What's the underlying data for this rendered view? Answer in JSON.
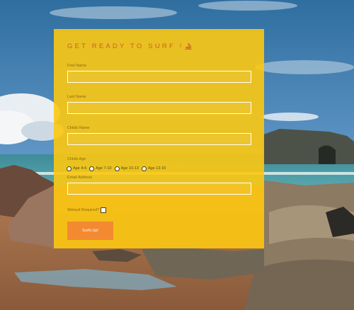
{
  "form": {
    "title": "GET READY TO SURF !",
    "fields": {
      "first_name": "First Name",
      "last_name": "Last Name",
      "childs_name": "Childs Name",
      "childs_age": "Childs Age",
      "email": "Email Address",
      "wetsuit": "Wetsuit Required?"
    },
    "age_options": [
      "Age 4-6",
      "Age 7-10",
      "Age 10-13",
      "Age 13-15"
    ],
    "submit_label": "Surfs Up!"
  },
  "colors": {
    "panel": "#fcc812",
    "title": "#c9602a",
    "button": "#f38a32"
  }
}
